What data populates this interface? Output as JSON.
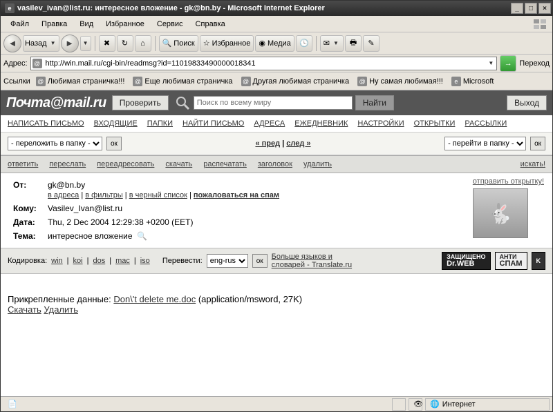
{
  "window": {
    "title": "vasilev_ivan@list.ru: интересное вложение - gk@bn.by - Microsoft Internet Explorer"
  },
  "menu": {
    "items": [
      "Файл",
      "Правка",
      "Вид",
      "Избранное",
      "Сервис",
      "Справка"
    ]
  },
  "toolbar": {
    "back": "Назад",
    "search": "Поиск",
    "favorites": "Избранное",
    "media": "Медиа"
  },
  "address": {
    "label": "Адрес:",
    "url": "http://win.mail.ru/cgi-bin/readmsg?id=11019833490000018341",
    "go": "Переход"
  },
  "links": {
    "label": "Ссылки",
    "items": [
      "Любимая страничка!!!",
      "Еще любимая страничка",
      "Другая любимая страничка",
      "Ну самая любимая!!!",
      "Microsoft"
    ]
  },
  "mail": {
    "logo": "Почта@mail.ru",
    "check": "Проверить",
    "search_placeholder": "Поиск по всему миру",
    "find": "Найти",
    "exit": "Выход",
    "nav": [
      "НАПИСАТЬ ПИСЬМО",
      "ВХОДЯЩИЕ",
      "ПАПКИ",
      "НАЙТИ ПИСЬМО",
      "АДРЕСА",
      "ЕЖЕДНЕВНИК",
      "НАСТРОЙКИ",
      "ОТКРЫТКИ",
      "РАССЫЛКИ"
    ],
    "move_to": "- переложить в папку -",
    "goto": "- перейти в папку -",
    "ok": "ок",
    "prev": "« пред",
    "next": "след »",
    "actions": [
      "ответить",
      "переслать",
      "переадресовать",
      "скачать",
      "распечатать",
      "заголовок",
      "удалить"
    ],
    "search_link": "искать!",
    "from_label": "От:",
    "from": "gk@bn.by",
    "from_links": [
      "в адреса",
      "в фильтры",
      "в черный список",
      "пожаловаться на спам"
    ],
    "to_label": "Кому:",
    "to": "Vasilev_Ivan@list.ru",
    "date_label": "Дата:",
    "date": "Thu, 2 Dec 2004 12:29:38 +0200 (EET)",
    "subject_label": "Тема:",
    "subject": "интересное вложение",
    "postcard": "отправить открытку!",
    "encoding_label": "Кодировка:",
    "encodings": [
      "win",
      "koi",
      "dos",
      "mac",
      "iso"
    ],
    "translate_label": "Перевести:",
    "translate_value": "eng-rus",
    "more_langs": "Больше языков и словарей - Translate.ru",
    "badge1a": "ЗАЩИЩЕНО",
    "badge1b": "Dr.WEB",
    "badge2a": "АНТИ",
    "badge2b": "СПАМ",
    "attach_label": "Прикрепленные данные:",
    "attach_name": "Don\\'t delete me.doc",
    "attach_meta": "(application/msword, 27K)",
    "attach_dl": "Скачать",
    "attach_del": "Удалить"
  },
  "status": {
    "zone": "Интернет"
  }
}
